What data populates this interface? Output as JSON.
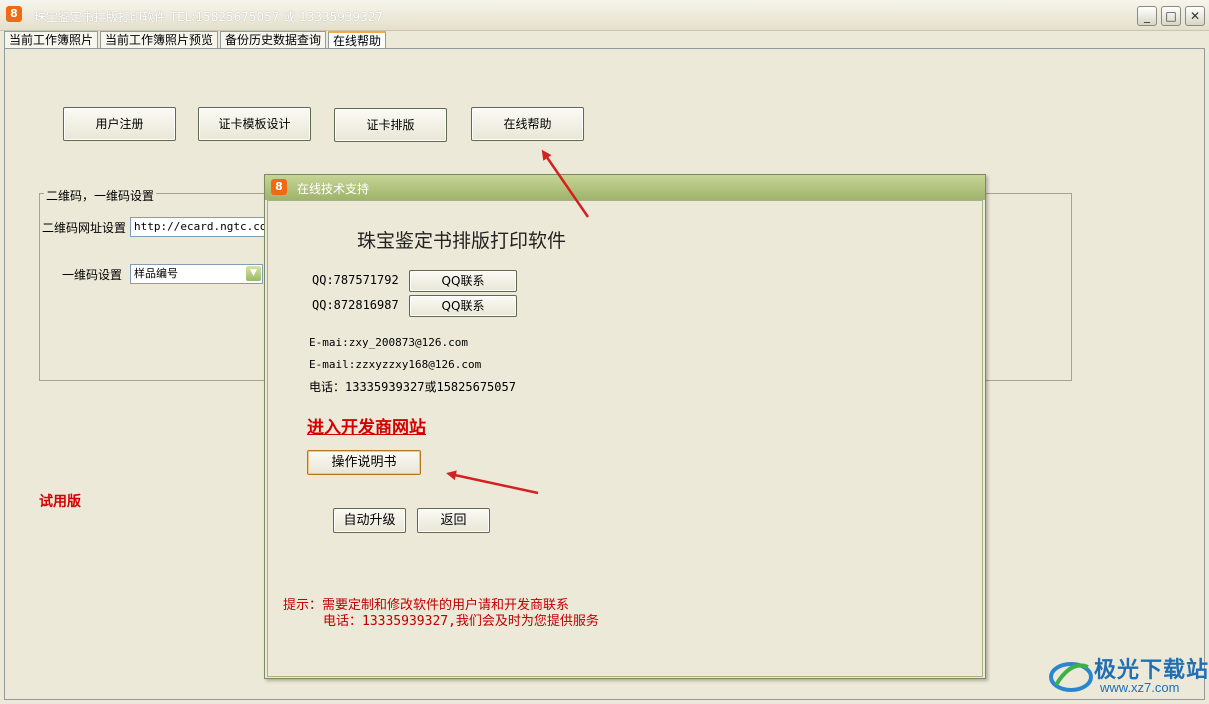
{
  "window": {
    "title": "珠宝鉴定书排版打印软件 TEL:15825675057 或 13335939327",
    "icon_glyph": "8",
    "minimize": "_",
    "maximize": "□",
    "close": "✕"
  },
  "tabs": [
    {
      "label": "当前工作簿照片"
    },
    {
      "label": "当前工作簿照片预览"
    },
    {
      "label": "备份历史数据查询"
    },
    {
      "label": "在线帮助",
      "active": true
    }
  ],
  "toolbar": {
    "register": "用户注册",
    "template": "证卡模板设计",
    "layout": "证卡排版",
    "help": "在线帮助"
  },
  "code_settings": {
    "group_label": "二维码，一维码设置",
    "qr_url_label": "二维码网址设置",
    "qr_url_value": "http://ecard.ngtc.com.",
    "barcode_label": "一维码设置",
    "barcode_value": "样品编号"
  },
  "trial_label": "试用版",
  "dialog": {
    "title": "在线技术支持",
    "icon_glyph": "8",
    "heading": "珠宝鉴定书排版打印软件",
    "qq1": "QQ:787571792",
    "qq2": "QQ:872816987",
    "qq_button": "QQ联系",
    "email1": "E-mai:zxy_200873@126.com",
    "email2": "E-mail:zzxyzzxy168@126.com",
    "phone": "电话：13335939327或15825675057",
    "dev_site_link": "进入开发商网站",
    "manual_button": "操作说明书",
    "auto_upgrade_button": "自动升级",
    "back_button": "返回",
    "tip_line1": "提示：需要定制和修改软件的用户请和开发商联系",
    "tip_line2": "电话：13335939327,我们会及时为您提供服务"
  },
  "watermark": {
    "text": "极光下载站",
    "url": "www.xz7.com"
  },
  "colors": {
    "background": "#ECE9D8",
    "dialog_title": "#9fb36b",
    "red_text": "#d40000",
    "arrow": "#d42020",
    "watermark": "#1f6fb7"
  }
}
